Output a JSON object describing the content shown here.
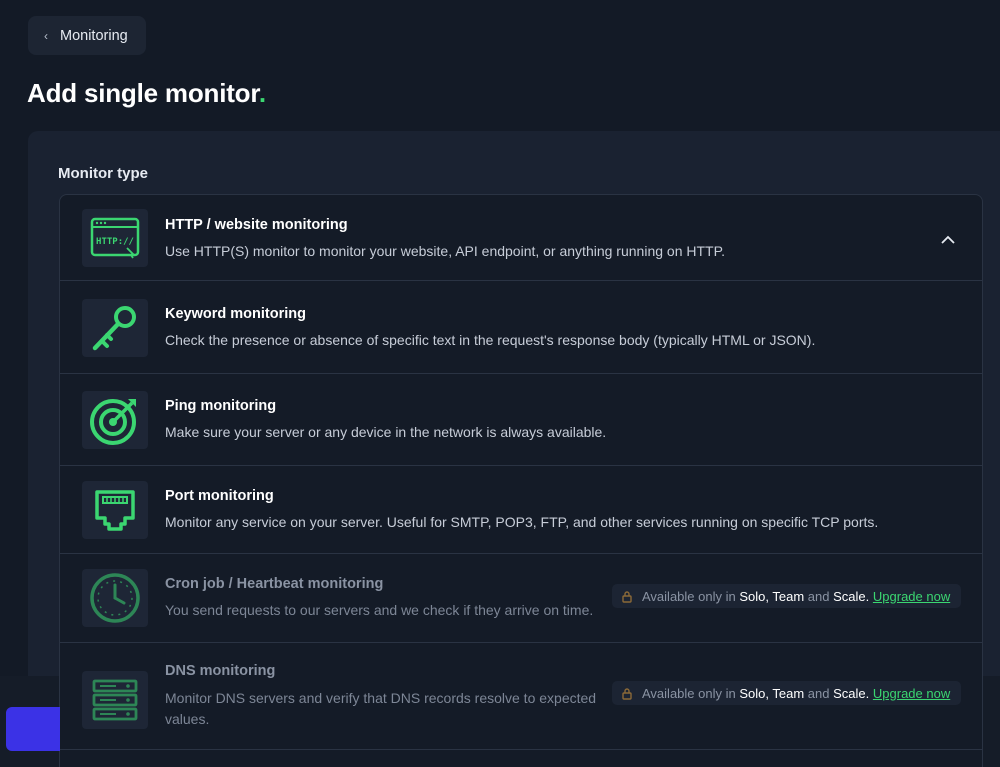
{
  "back": {
    "label": "Monitoring"
  },
  "page": {
    "title": "Add single monitor",
    "title_dot": "."
  },
  "section": {
    "label": "Monitor type"
  },
  "monitors": [
    {
      "title": "HTTP / website monitoring",
      "desc": "Use HTTP(S) monitor to monitor your website, API endpoint, or anything running on HTTP.",
      "icon": "http-icon",
      "selected": true
    },
    {
      "title": "Keyword monitoring",
      "desc": "Check the presence or absence of specific text in the request's response body (typically HTML or JSON).",
      "icon": "key-icon"
    },
    {
      "title": "Ping monitoring",
      "desc": "Make sure your server or any device in the network is always available.",
      "icon": "target-icon"
    },
    {
      "title": "Port monitoring",
      "desc": "Monitor any service on your server. Useful for SMTP, POP3, FTP, and other services running on specific TCP ports.",
      "icon": "ethernet-port-icon"
    },
    {
      "title": "Cron job / Heartbeat monitoring",
      "desc": "You send requests to our servers and we check if they arrive on time.",
      "icon": "clock-icon",
      "locked": true
    },
    {
      "title": "DNS monitoring",
      "desc_line1": "Monitor DNS servers and verify that DNS records resolve to expected",
      "desc_line2": "values.",
      "icon": "server-stack-icon",
      "locked": true
    }
  ],
  "upsell": {
    "prefix": "Available only in",
    "plan1": "Solo,",
    "plan2": "Team",
    "and": "and",
    "plan3": "Scale.",
    "link": "Upgrade now"
  },
  "http_icon_text": "HTTP://",
  "colors": {
    "accent": "#3bd671",
    "background": "#131a26",
    "panel": "#1a2231",
    "primary_button": "#3b32e6"
  }
}
